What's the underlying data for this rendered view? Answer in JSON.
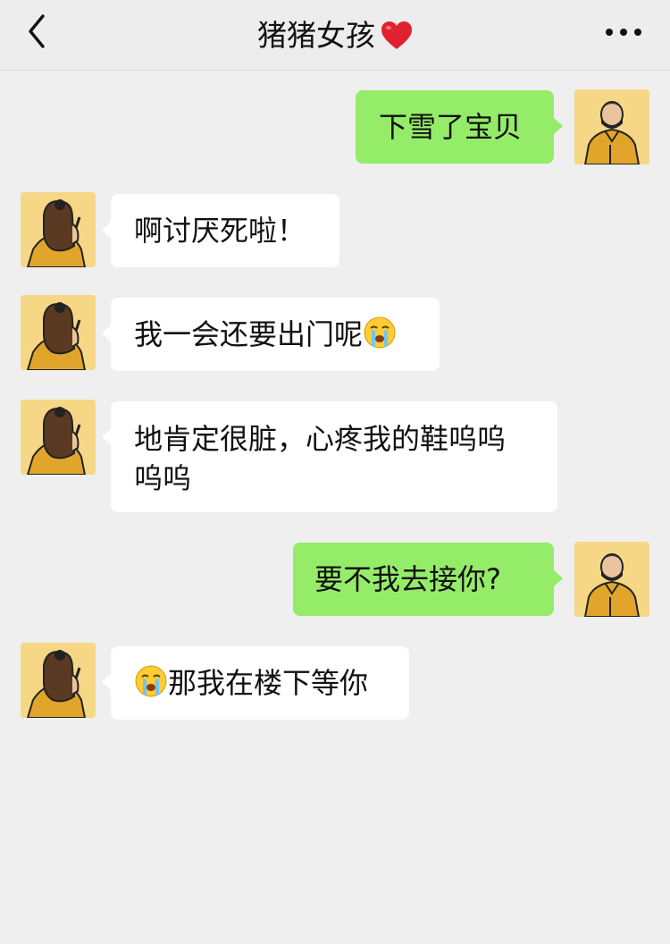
{
  "header": {
    "title": "猪猪女孩",
    "title_emoji": "red-heart-icon",
    "back_icon": "chevron-left-icon",
    "more_icon": "more-dots-icon"
  },
  "colors": {
    "background": "#efeff0",
    "header_background": "#ededed",
    "incoming_bubble": "#ffffff",
    "outgoing_bubble": "#95ec69",
    "avatar_background": "#f6d785",
    "heart": "#e02130"
  },
  "messages": [
    {
      "sender": "me",
      "text": "下雪了宝贝"
    },
    {
      "sender": "her",
      "text": "啊讨厌死啦！"
    },
    {
      "sender": "her",
      "text": "我一会还要出门呢",
      "emoji_after": "crying-face-icon"
    },
    {
      "sender": "her",
      "text_line1": "地肯定很脏，心疼我的鞋呜呜",
      "text_line2": "呜呜"
    },
    {
      "sender": "me",
      "text": "要不我去接你?"
    },
    {
      "sender": "her",
      "emoji_before": "crying-face-icon",
      "text": "那我在楼下等你"
    }
  ]
}
